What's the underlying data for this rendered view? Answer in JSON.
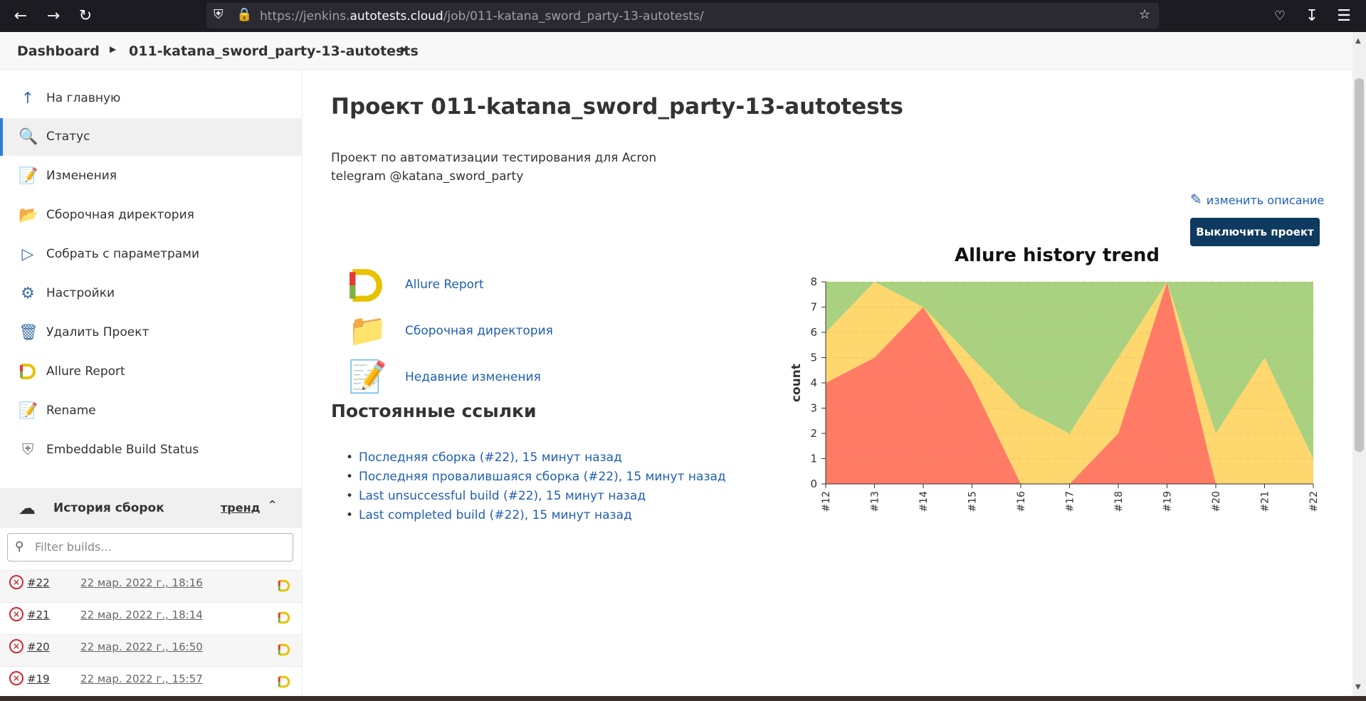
{
  "browser": {
    "url_prefix": "https://jenkins.",
    "url_domain": "autotests.cloud",
    "url_path": "/job/011-katana_sword_party-13-autotests/"
  },
  "breadcrumb": {
    "items": [
      "Dashboard",
      "011-katana_sword_party-13-autotests"
    ]
  },
  "sidebar": {
    "items": [
      {
        "label": "На главную",
        "icon": "arrow-up-icon"
      },
      {
        "label": "Статус",
        "icon": "magnifier-icon"
      },
      {
        "label": "Изменения",
        "icon": "notepad-icon"
      },
      {
        "label": "Сборочная директория",
        "icon": "folder-icon"
      },
      {
        "label": "Собрать с параметрами",
        "icon": "play-icon"
      },
      {
        "label": "Настройки",
        "icon": "gear-icon"
      },
      {
        "label": "Удалить Проект",
        "icon": "trash-icon"
      },
      {
        "label": "Allure Report",
        "icon": "allure-icon"
      },
      {
        "label": "Rename",
        "icon": "notepad-icon"
      },
      {
        "label": "Embeddable Build Status",
        "icon": "shield-icon"
      }
    ],
    "history": {
      "title": "История сборок",
      "trend": "тренд",
      "filter_placeholder": "Filter builds...",
      "builds": [
        {
          "num": "#22",
          "date": "22 мар. 2022 г., 18:16"
        },
        {
          "num": "#21",
          "date": "22 мар. 2022 г., 18:14"
        },
        {
          "num": "#20",
          "date": "22 мар. 2022 г., 16:50"
        },
        {
          "num": "#19",
          "date": "22 мар. 2022 г., 15:57"
        }
      ]
    }
  },
  "main": {
    "title": "Проект 011-katana_sword_party-13-autotests",
    "description_line1": "Проект по автоматизации тестирования для Acron",
    "description_line2": "telegram @katana_sword_party",
    "edit_description": "изменить описание",
    "disable_button": "Выключить проект",
    "links": [
      {
        "label": "Allure Report",
        "icon": "allure-icon"
      },
      {
        "label": "Сборочная директория",
        "icon": "folder-icon"
      },
      {
        "label": "Недавние изменения",
        "icon": "notepad-icon"
      }
    ],
    "permalinks_title": "Постоянные ссылки",
    "permalinks": [
      "Последняя сборка (#22), 15 минут назад",
      "Последняя провалившаяся сборка (#22), 15 минут назад",
      "Last unsuccessful build (#22), 15 минут назад",
      "Last completed build (#22), 15 минут назад"
    ]
  },
  "colors": {
    "failed": "#ff7b66",
    "broken": "#fed76f",
    "passed": "#a9d17f",
    "link": "#1f5fb3",
    "button": "#0f3a5f"
  },
  "chart_data": {
    "type": "area",
    "title": "Allure history trend",
    "ylabel": "count",
    "xlabel": "",
    "x": [
      "#12",
      "#13",
      "#14",
      "#15",
      "#16",
      "#17",
      "#18",
      "#19",
      "#20",
      "#21",
      "#22"
    ],
    "ylim": [
      0,
      8
    ],
    "yticks": [
      0,
      1,
      2,
      3,
      4,
      5,
      6,
      7,
      8
    ],
    "stacked": true,
    "grid": true,
    "series": [
      {
        "key": "failed",
        "values": [
          4,
          5,
          7,
          4,
          0,
          0,
          2,
          8,
          0,
          0,
          0
        ]
      },
      {
        "key": "broken",
        "values": [
          2,
          3,
          0,
          1,
          3,
          2,
          3,
          0,
          2,
          5,
          1
        ]
      },
      {
        "key": "passed",
        "values": [
          2,
          0,
          1,
          3,
          5,
          6,
          3,
          0,
          6,
          3,
          7
        ]
      }
    ]
  }
}
